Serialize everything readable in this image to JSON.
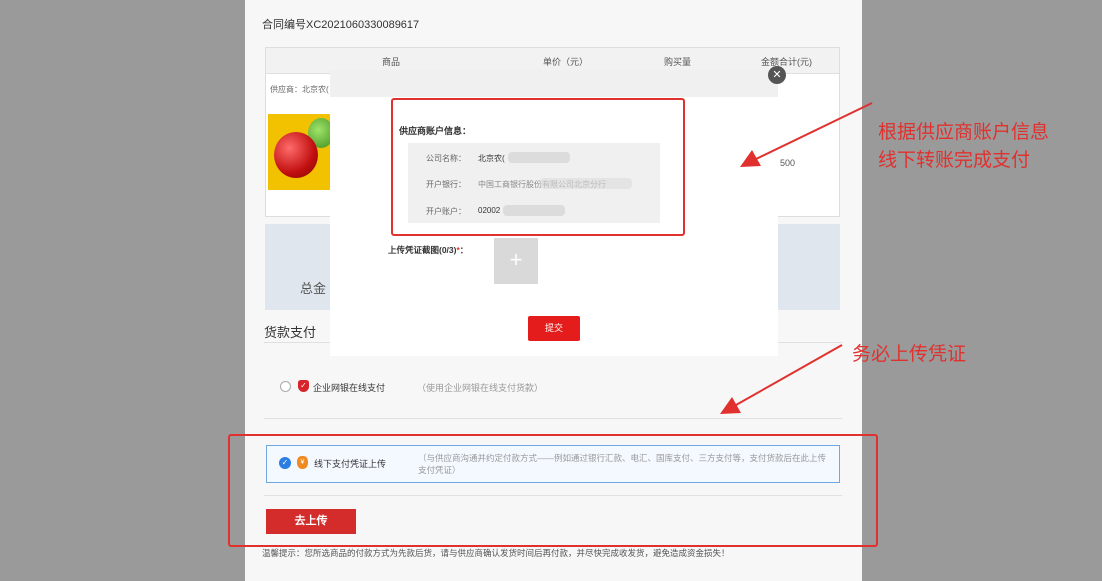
{
  "contract": {
    "label": "合同编号XC2021060330089617"
  },
  "table": {
    "headers": [
      "商品",
      "单价（元）",
      "购买量",
      "金额合计(元)"
    ],
    "supplier": "供应商：北京农(",
    "price_fragment": "500"
  },
  "summary": {
    "total_label": "总金"
  },
  "payment": {
    "section_title": "货款支付",
    "online": {
      "label": "企业网银在线支付",
      "note": "（使用企业网银在线支付货款）"
    },
    "offline": {
      "label": "线下支付凭证上传",
      "note": "（与供应商沟通并约定付款方式——例如通过银行汇款、电汇、国库支付、三方支付等，支付货款后在此上传支付凭证）"
    },
    "upload_button": "去上传",
    "tip": "温馨提示：您所选商品的付款方式为先款后货，请与供应商确认发货时间后再付款，并尽快完成收发货，避免造成资金损失！"
  },
  "modal": {
    "close_icon": "close-icon",
    "info_title": "供应商账户信息：",
    "company_label": "公司名称：",
    "company_value": "北京农(",
    "bank_label": "开户银行：",
    "bank_value": "中国工商银行股份有限公司北京分行",
    "account_label": "开户账户：",
    "account_value": "02002",
    "upload_label": "上传凭证截图(0/3)",
    "upload_required": "*",
    "upload_colon": "：",
    "plus_icon": "+",
    "submit": "提交"
  },
  "annotations": {
    "top_line1": "根据供应商账户信息",
    "top_line2": "线下转账完成支付",
    "bottom": "务必上传凭证"
  },
  "colors": {
    "accent_red": "#e0312e",
    "button_red": "#d42b2b",
    "selected_blue": "#2a7de1"
  }
}
